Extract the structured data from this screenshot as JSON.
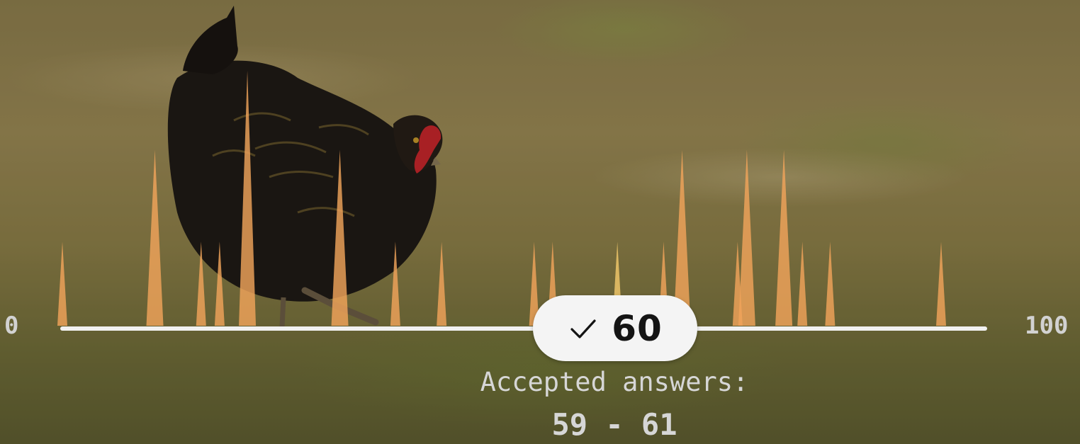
{
  "slider": {
    "min_label": "0",
    "max_label": "100",
    "answer_value": "60",
    "answer_icon": "check-icon"
  },
  "result": {
    "caption": "Accepted answers:",
    "range": "59 - 61"
  },
  "colors": {
    "spike": "#f0a35a",
    "spike_highlight": "#f2c86a",
    "track": "#f1f1f1",
    "pill": "#f4f4f4"
  },
  "chart_data": {
    "type": "bar",
    "description_scale": "relative answer frequency along 0-100 slider",
    "x": [
      0,
      10,
      15,
      17,
      20,
      30,
      36,
      41,
      51,
      53,
      60,
      65,
      67,
      73,
      74,
      78,
      80,
      83,
      95
    ],
    "values": [
      0.33,
      0.69,
      0.33,
      0.33,
      1.0,
      0.69,
      0.33,
      0.33,
      0.33,
      0.33,
      0.33,
      0.33,
      0.69,
      0.33,
      0.69,
      0.69,
      0.33,
      0.33,
      0.33
    ]
  }
}
